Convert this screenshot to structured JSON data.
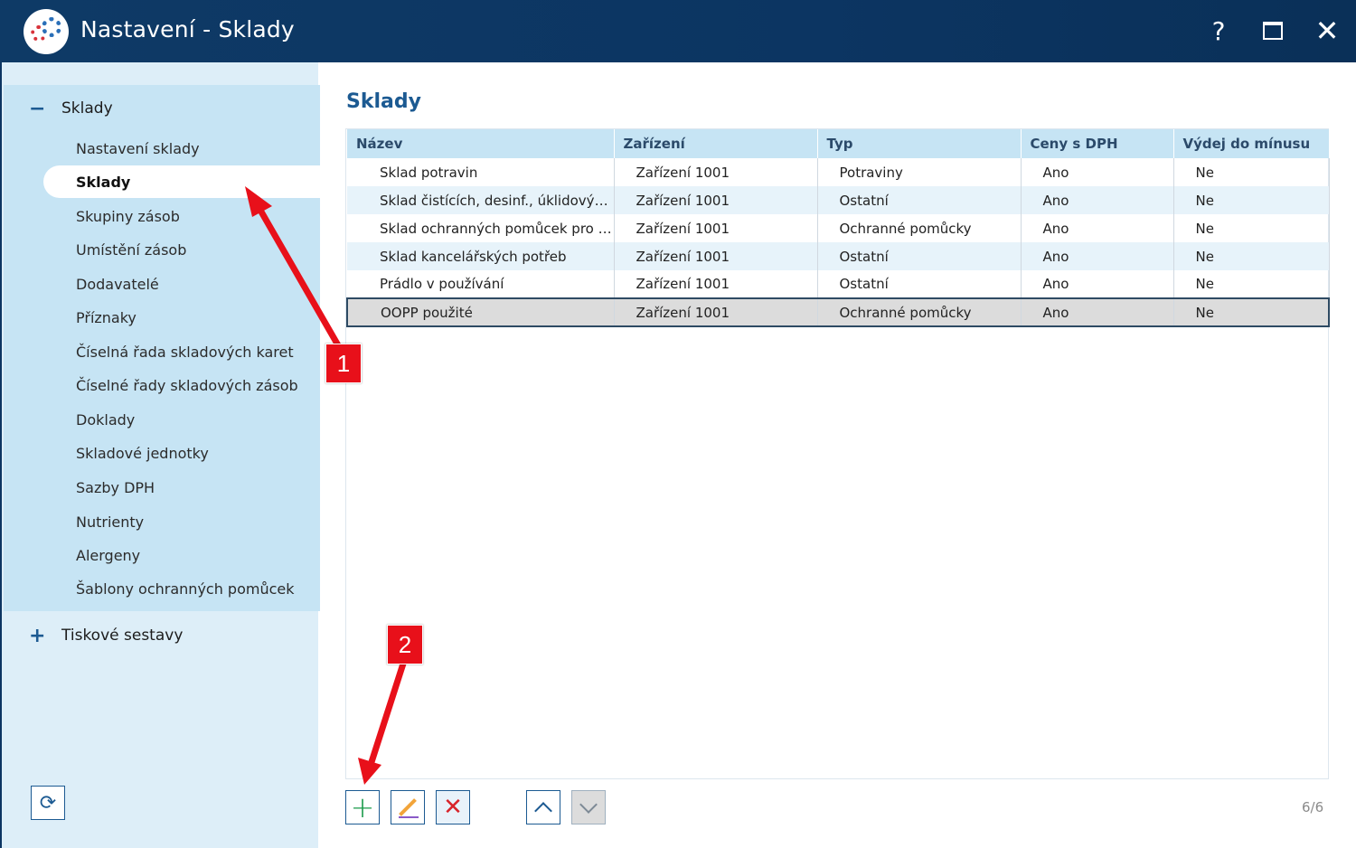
{
  "window": {
    "title": "Nastavení - Sklady",
    "help_label": "?",
    "close_label": "✕"
  },
  "sidebar": {
    "groups": [
      {
        "label": "Sklady",
        "expanded": true,
        "symbol": "−"
      },
      {
        "label": "Tiskové sestavy",
        "expanded": false,
        "symbol": "+"
      }
    ],
    "items": [
      {
        "label": "Nastavení sklady"
      },
      {
        "label": "Sklady",
        "active": true
      },
      {
        "label": "Skupiny zásob"
      },
      {
        "label": "Umístění zásob"
      },
      {
        "label": "Dodavatelé"
      },
      {
        "label": "Příznaky"
      },
      {
        "label": "Číselná řada skladových karet"
      },
      {
        "label": "Číselné řady skladových zásob"
      },
      {
        "label": "Doklady"
      },
      {
        "label": "Skladové jednotky"
      },
      {
        "label": "Sazby DPH"
      },
      {
        "label": "Nutrienty"
      },
      {
        "label": "Alergeny"
      },
      {
        "label": "Šablony ochranných pomůcek"
      }
    ],
    "refresh_icon": "refresh-icon"
  },
  "main": {
    "title": "Sklady",
    "columns": [
      "Název",
      "Zařízení",
      "Typ",
      "Ceny s DPH",
      "Výdej do mínusu"
    ],
    "rows": [
      [
        "Sklad potravin",
        "Zařízení 1001",
        "Potraviny",
        "Ano",
        "Ne"
      ],
      [
        "Sklad čistících, desinf., úklidových prostředků",
        "Zařízení 1001",
        "Ostatní",
        "Ano",
        "Ne"
      ],
      [
        "Sklad ochranných pomůcek pro zaměstnance",
        "Zařízení 1001",
        "Ochranné pomůcky",
        "Ano",
        "Ne"
      ],
      [
        "Sklad kancelářských potřeb",
        "Zařízení 1001",
        "Ostatní",
        "Ano",
        "Ne"
      ],
      [
        "Prádlo v používání",
        "Zařízení 1001",
        "Ostatní",
        "Ano",
        "Ne"
      ],
      [
        "OOPP použité",
        "Zařízení 1001",
        "Ochranné pomůcky",
        "Ano",
        "Ne"
      ]
    ],
    "selected_row": 5,
    "toolbar": {
      "add_icon": "plus-icon",
      "edit_icon": "pencil-icon",
      "delete_icon": "x-icon",
      "up_icon": "chevron-up-icon",
      "down_icon": "chevron-down-icon"
    },
    "record_counter": "6/6"
  },
  "annotations": {
    "badge_1": "1",
    "badge_2": "2",
    "color": "#e8101a"
  }
}
